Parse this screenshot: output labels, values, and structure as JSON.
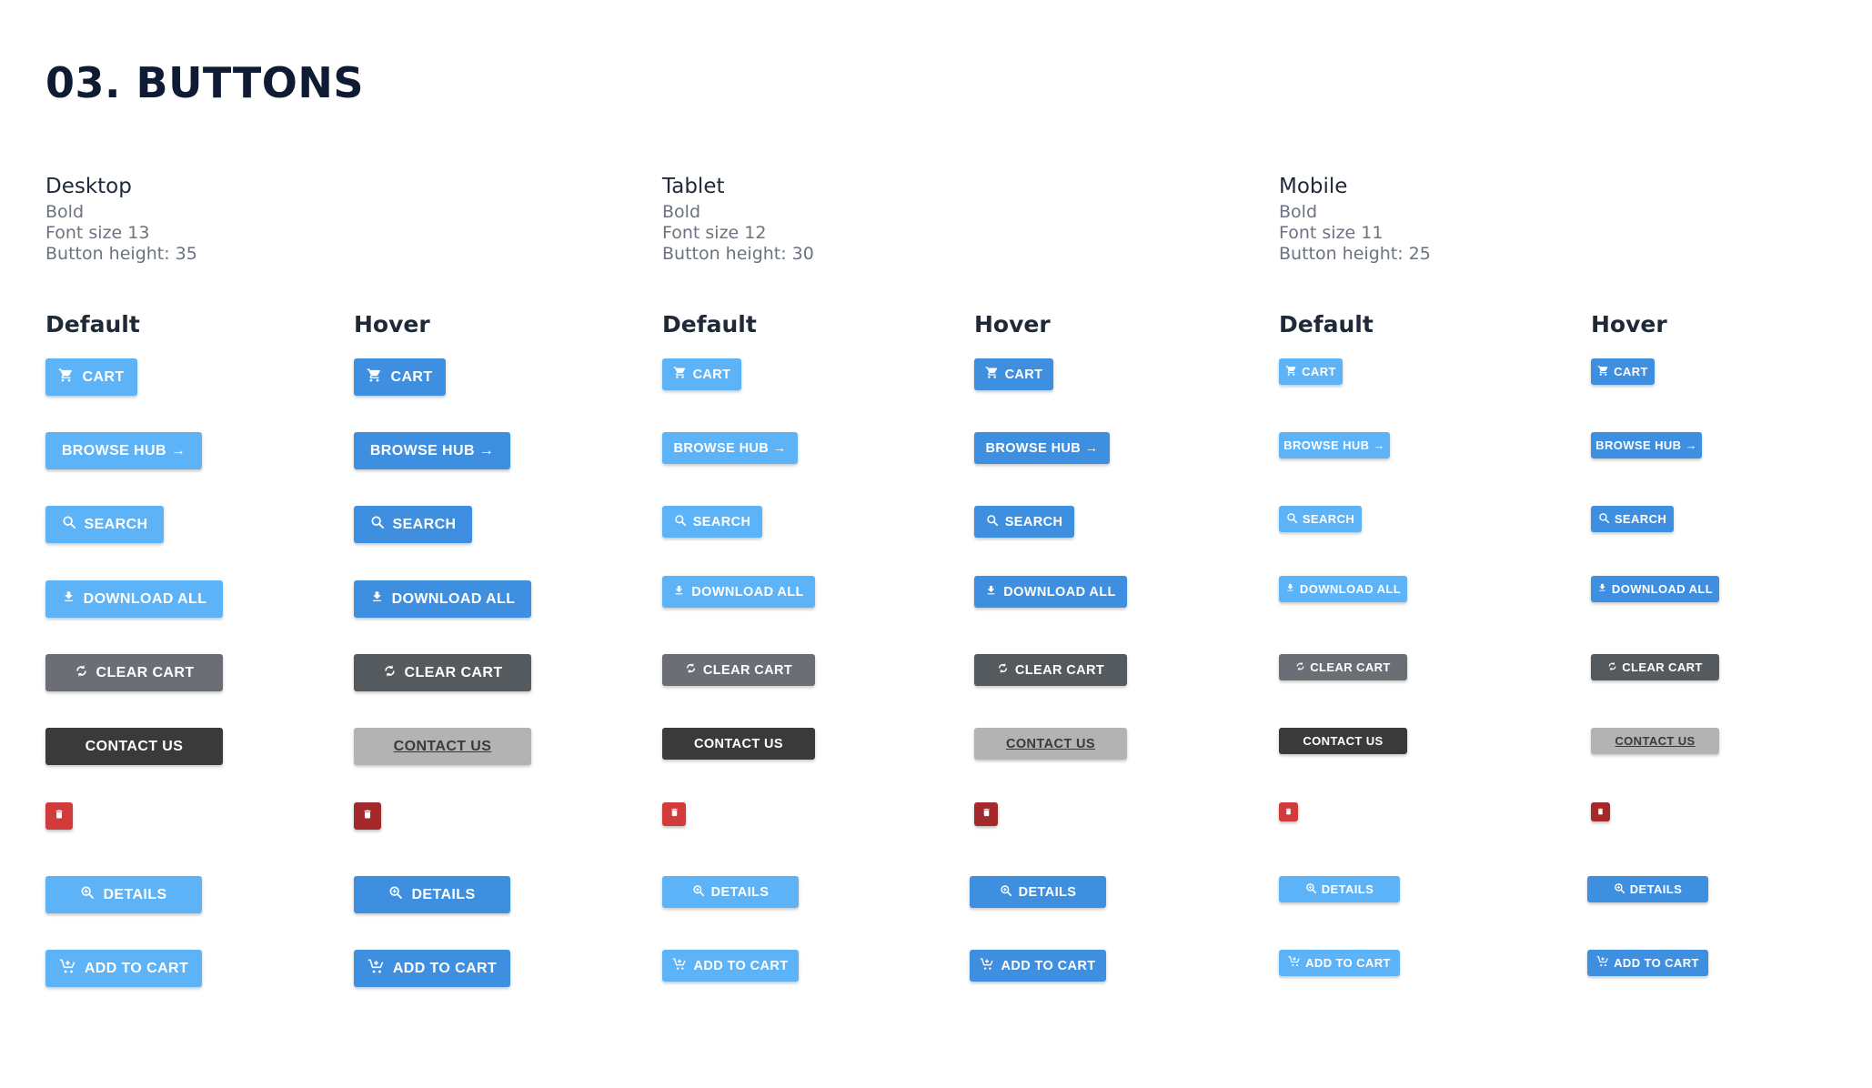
{
  "page_title": "03. BUTTONS",
  "devices": [
    {
      "name": "Desktop",
      "weight": "Bold",
      "font_size": "Font size 13",
      "height": "Button height: 35"
    },
    {
      "name": "Tablet",
      "weight": "Bold",
      "font_size": "Font size 12",
      "height": "Button height: 30"
    },
    {
      "name": "Mobile",
      "weight": "Bold",
      "font_size": "Font size 11",
      "height": "Button height:  25"
    }
  ],
  "states": {
    "default": "Default",
    "hover": "Hover"
  },
  "buttons": {
    "cart": "CART",
    "browse_hub": "BROWSE HUB →",
    "search": "SEARCH",
    "download_all": "DOWNLOAD ALL",
    "clear_cart": "CLEAR CART",
    "contact_us": "CONTACT US",
    "details": "DETAILS",
    "add_to_cart": "ADD TO CART"
  },
  "icons": {
    "cart": "cart-icon",
    "search": "search-icon",
    "download": "download-icon",
    "refresh": "refresh-icon",
    "trash": "trash-icon",
    "zoom": "zoom-icon",
    "add_to_cart": "add-to-cart-icon"
  },
  "colors": {
    "primary_default": "#5cb3f8",
    "primary_hover": "#3f8fe0",
    "clear_default": "#6b6f75",
    "clear_hover": "#555a5e",
    "contact_default": "#3a3a3a",
    "contact_hover": "#b3b3b3",
    "danger_default": "#d13b3b",
    "danger_hover": "#a3292b",
    "title": "#0e1b33"
  }
}
